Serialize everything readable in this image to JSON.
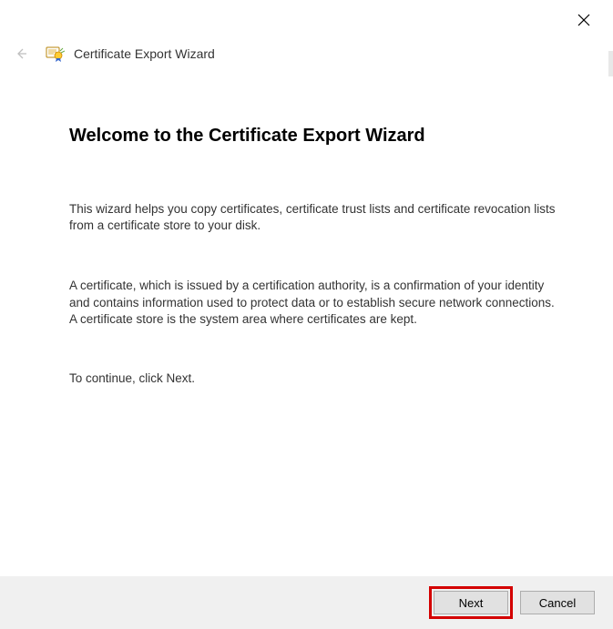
{
  "header": {
    "wizard_title": "Certificate Export Wizard"
  },
  "content": {
    "heading": "Welcome to the Certificate Export Wizard",
    "para1": "This wizard helps you copy certificates, certificate trust lists and certificate revocation lists from a certificate store to your disk.",
    "para2": "A certificate, which is issued by a certification authority, is a confirmation of your identity and contains information used to protect data or to establish secure network connections. A certificate store is the system area where certificates are kept.",
    "continue": "To continue, click Next."
  },
  "footer": {
    "next_label": "Next",
    "cancel_label": "Cancel"
  }
}
